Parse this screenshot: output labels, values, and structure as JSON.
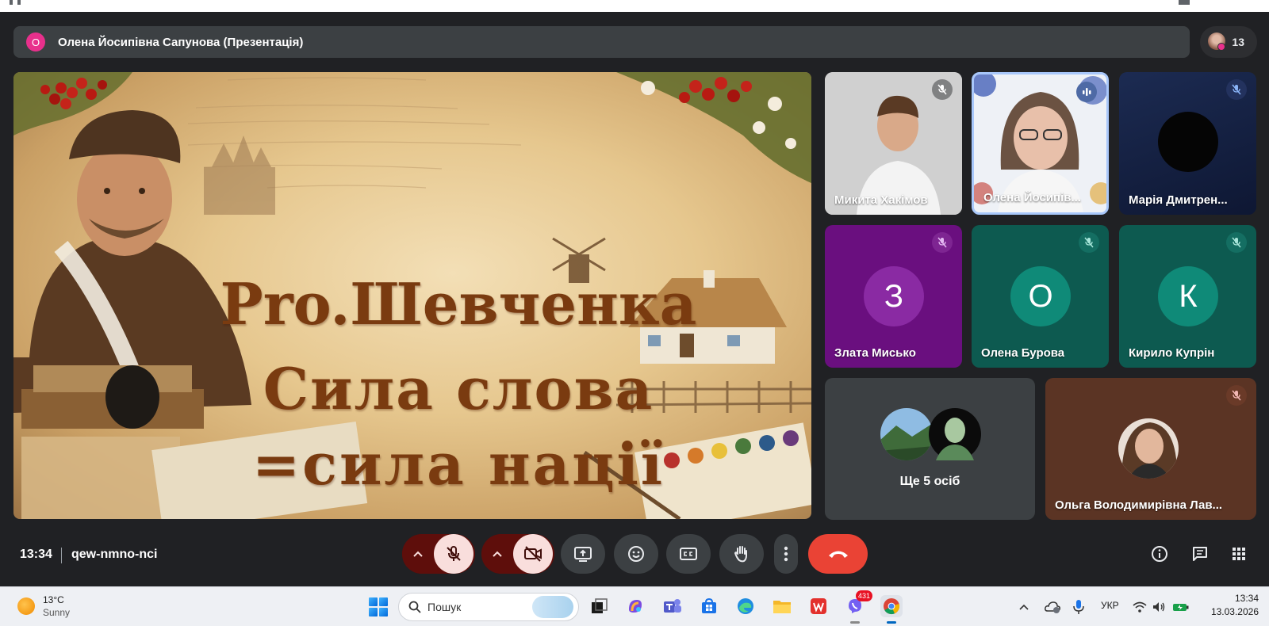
{
  "presenter": {
    "avatar_letter": "О",
    "title": "Олена Йосипівна Сапунова (Презентація)",
    "avatar_color": "#e8308c"
  },
  "people_button": {
    "count": "13"
  },
  "slide": {
    "line1": "Pro.Шевченка",
    "line2": "Сила слова",
    "line3": "=сила нації",
    "text_color": "#7a3b10"
  },
  "participants": [
    {
      "name": "Микита Хакімов",
      "muted": true
    },
    {
      "name": "Олена Йосипів...",
      "muted": false,
      "speaking": true
    },
    {
      "name": "Марія Дмитрен...",
      "muted": true
    },
    {
      "name": "Злата Мисько",
      "letter": "З",
      "muted": true,
      "tile_color": "#6a0f7f",
      "avatar_color": "#8a2aa3"
    },
    {
      "name": "Олена Бурова",
      "letter": "О",
      "muted": true,
      "tile_color": "#0d5a50",
      "avatar_color": "#0f8a78"
    },
    {
      "name": "Кирило Купрін",
      "letter": "К",
      "muted": true,
      "tile_color": "#0d5a50",
      "avatar_color": "#0f8a78"
    },
    {
      "name": "Ольга Володимирівна Лав...",
      "muted": true
    }
  ],
  "more_people": {
    "label": "Ще 5 осіб"
  },
  "meet_bar": {
    "time": "13:34",
    "meeting_code": "qew-nmno-nci",
    "end_call_color": "#ea4335"
  },
  "taskbar": {
    "weather": {
      "temp": "13°C",
      "condition": "Sunny"
    },
    "search_placeholder": "Пошук",
    "viber_badge": "431",
    "language": "УКР",
    "clock": {
      "time": "13:34",
      "date": "13.03.2026"
    }
  }
}
